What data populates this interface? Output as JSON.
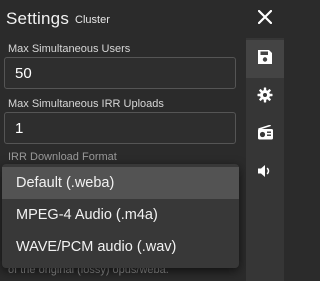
{
  "header": {
    "title": "Settings",
    "subtitle": "Cluster"
  },
  "fields": {
    "max_users": {
      "label": "Max Simultaneous Users",
      "value": "50"
    },
    "max_uploads": {
      "label": "Max Simultaneous IRR Uploads",
      "value": "1"
    },
    "download_format": {
      "label": "IRR Download Format",
      "helper_text": "of the original (lossy) opus/weba."
    }
  },
  "dropdown": {
    "options": [
      "Default (.weba)",
      "MPEG-4 Audio (.m4a)",
      "WAVE/PCM audio (.wav)"
    ],
    "selected_index": 0
  },
  "rail": {
    "icons": [
      "close-icon",
      "save-icon",
      "gear-icon",
      "radio-icon",
      "speaker-icon"
    ]
  },
  "colors": {
    "background": "#2b2b2b",
    "rail": "#363636",
    "dropdown": "#383838",
    "selected_option": "#535353"
  }
}
